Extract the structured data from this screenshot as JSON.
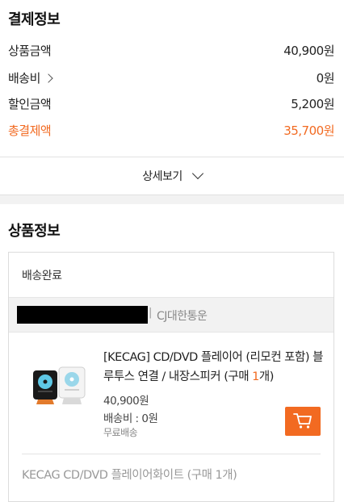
{
  "payment": {
    "title": "결제정보",
    "rows": [
      {
        "label": "상품금액",
        "value": "40,900원"
      },
      {
        "label": "배송비",
        "value": "0원"
      },
      {
        "label": "할인금액",
        "value": "5,200원"
      },
      {
        "label": "총결제액",
        "value": "35,700원"
      }
    ],
    "detail_toggle_label": "상세보기"
  },
  "product_info": {
    "title": "상품정보",
    "delivery_status": "배송완료",
    "courier_separator": "|",
    "courier": "CJ대한통운",
    "item": {
      "name_part1": "[KECAG] CD/DVD 플레이어 (리모컨 포함) 블루투스 연결 / 내장스피커 (구매 ",
      "qty": "1",
      "name_part2": "개)",
      "price": "40,900원",
      "shipping_fee": "배송비 : 0원",
      "shipping_note": "무료배송"
    },
    "option_text": "KECAG CD/DVD 플레이어화이트 (구매 1개)"
  },
  "colors": {
    "accent": "#f26a21"
  },
  "icons": [
    "chevron-right-icon",
    "chevron-down-icon",
    "cart-icon"
  ]
}
